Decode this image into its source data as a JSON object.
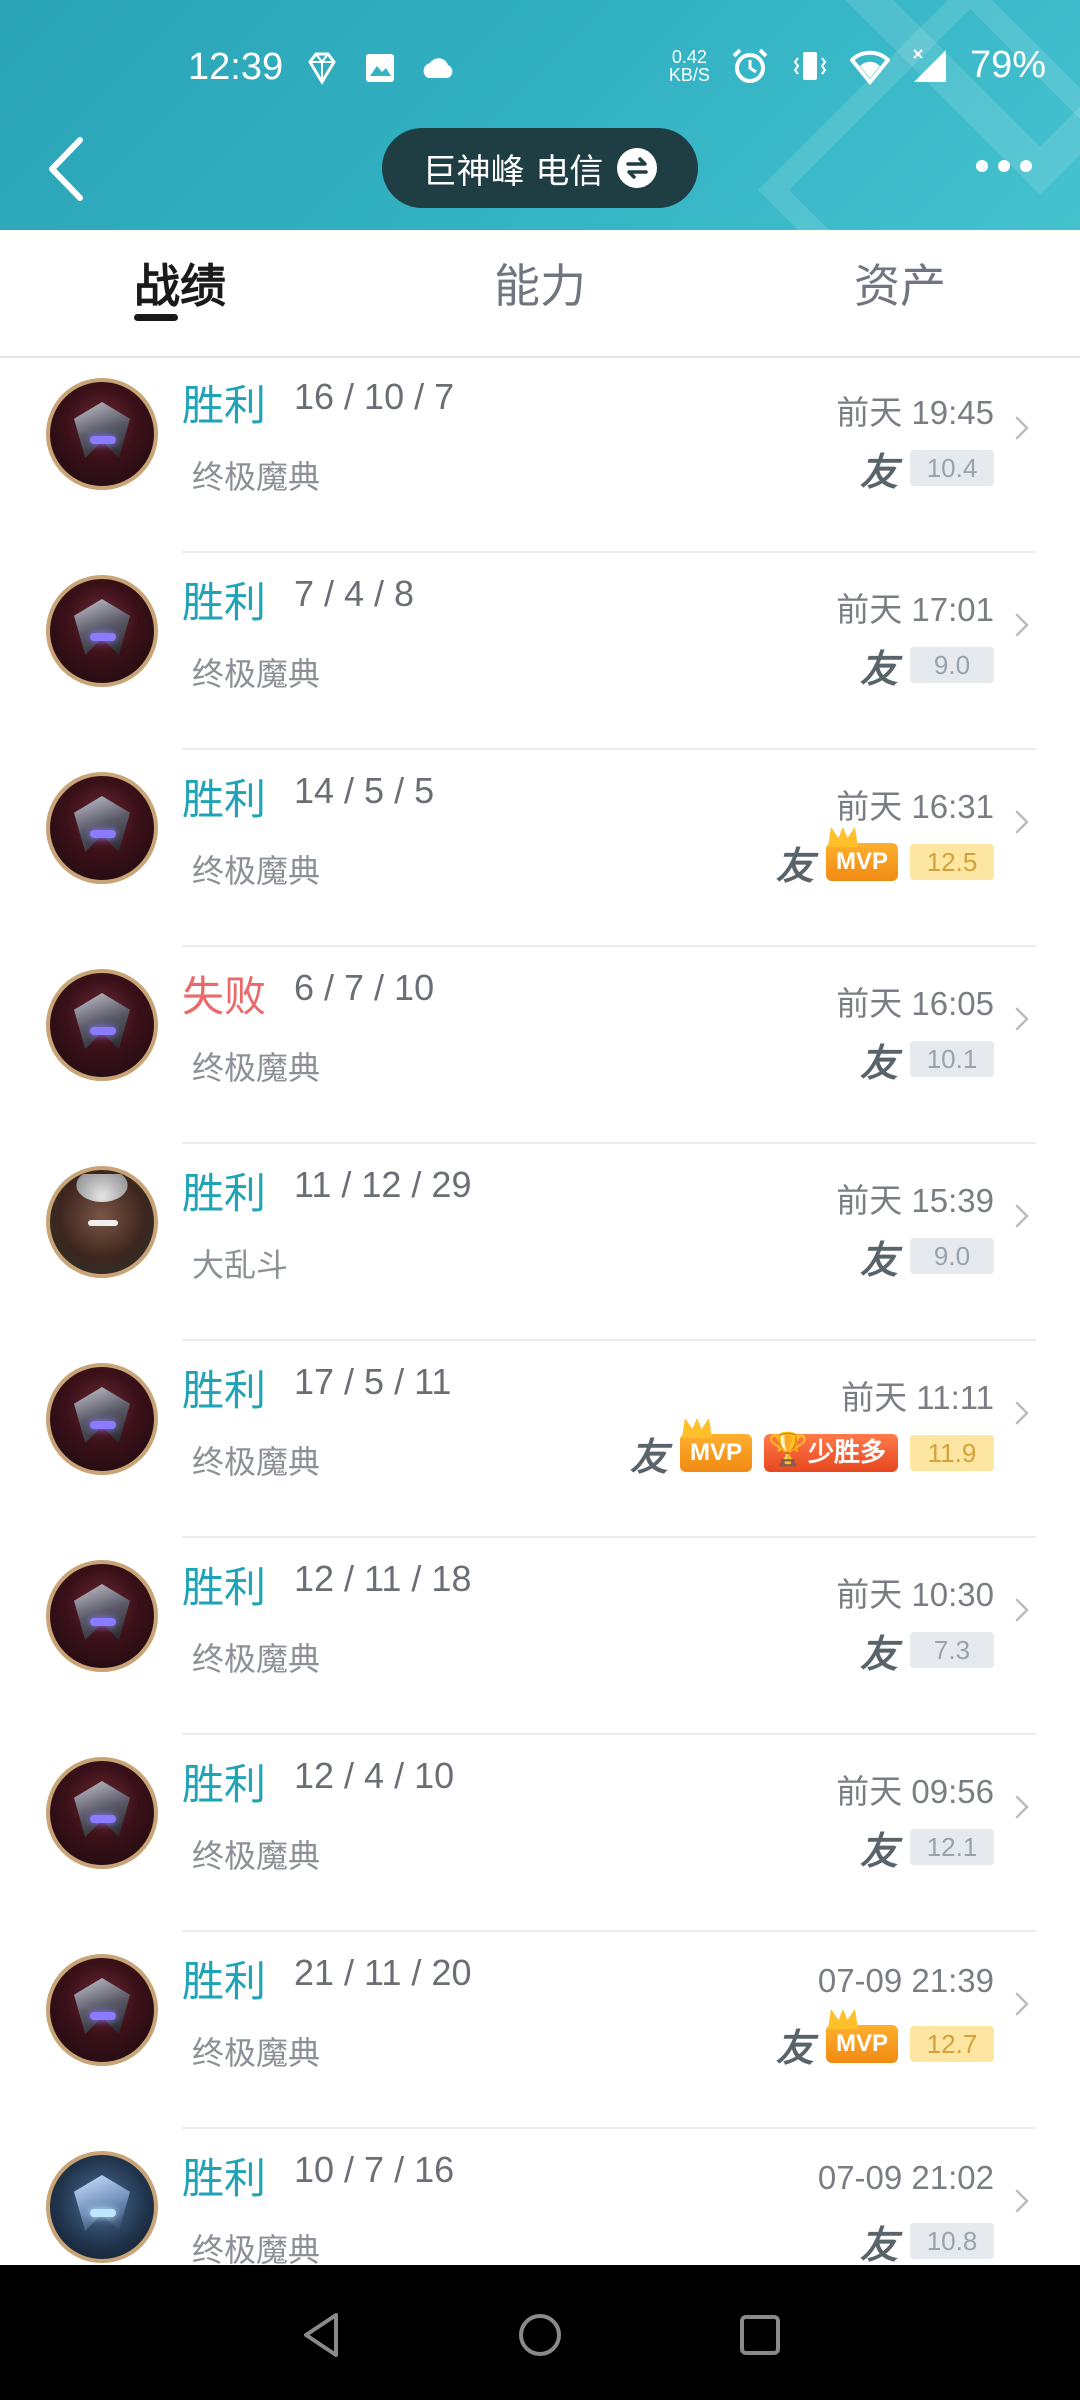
{
  "status_bar": {
    "time": "12:39",
    "net_speed_value": "0.42",
    "net_speed_unit": "KB/S",
    "battery": "79%",
    "icons_left": [
      "diamond-app-icon",
      "image-icon",
      "cloud-icon"
    ],
    "icons_right": [
      "alarm-icon",
      "vibrate-icon",
      "wifi-icon",
      "signal-icon"
    ]
  },
  "nav": {
    "server_label": "巨神峰 电信",
    "back_icon": "back-chevron-icon",
    "more_icon": "more-dots-icon",
    "swap_icon": "swap-icon"
  },
  "tabs": [
    {
      "label": "战绩",
      "active": true
    },
    {
      "label": "能力",
      "active": false
    },
    {
      "label": "资产",
      "active": false
    }
  ],
  "matches": [
    {
      "result": "胜利",
      "outcome": "win",
      "kda": "16 / 10 / 7",
      "mode": "终极魔典",
      "time": "前天 19:45",
      "friend": "友",
      "mvp": false,
      "few_wins": false,
      "score": "10.4",
      "score_style": "grey",
      "avatar": "a"
    },
    {
      "result": "胜利",
      "outcome": "win",
      "kda": "7 / 4 / 8",
      "mode": "终极魔典",
      "time": "前天 17:01",
      "friend": "友",
      "mvp": false,
      "few_wins": false,
      "score": "9.0",
      "score_style": "grey",
      "avatar": "a"
    },
    {
      "result": "胜利",
      "outcome": "win",
      "kda": "14 / 5 / 5",
      "mode": "终极魔典",
      "time": "前天 16:31",
      "friend": "友",
      "mvp": true,
      "few_wins": false,
      "score": "12.5",
      "score_style": "gold",
      "avatar": "a"
    },
    {
      "result": "失败",
      "outcome": "lose",
      "kda": "6 / 7 / 10",
      "mode": "终极魔典",
      "time": "前天 16:05",
      "friend": "友",
      "mvp": false,
      "few_wins": false,
      "score": "10.1",
      "score_style": "grey",
      "avatar": "a"
    },
    {
      "result": "胜利",
      "outcome": "win",
      "kda": "11 / 12 / 29",
      "mode": "大乱斗",
      "time": "前天 15:39",
      "friend": "友",
      "mvp": false,
      "few_wins": false,
      "score": "9.0",
      "score_style": "grey",
      "avatar": "b"
    },
    {
      "result": "胜利",
      "outcome": "win",
      "kda": "17 / 5 / 11",
      "mode": "终极魔典",
      "time": "前天 11:11",
      "friend": "友",
      "mvp": true,
      "few_wins": true,
      "few_wins_label": "少胜多",
      "score": "11.9",
      "score_style": "gold",
      "avatar": "a"
    },
    {
      "result": "胜利",
      "outcome": "win",
      "kda": "12 / 11 / 18",
      "mode": "终极魔典",
      "time": "前天 10:30",
      "friend": "友",
      "mvp": false,
      "few_wins": false,
      "score": "7.3",
      "score_style": "grey",
      "avatar": "a"
    },
    {
      "result": "胜利",
      "outcome": "win",
      "kda": "12 / 4 / 10",
      "mode": "终极魔典",
      "time": "前天 09:56",
      "friend": "友",
      "mvp": false,
      "few_wins": false,
      "score": "12.1",
      "score_style": "grey",
      "avatar": "a"
    },
    {
      "result": "胜利",
      "outcome": "win",
      "kda": "21 / 11 / 20",
      "mode": "终极魔典",
      "time": "07-09 21:39",
      "friend": "友",
      "mvp": true,
      "few_wins": false,
      "score": "12.7",
      "score_style": "gold",
      "avatar": "a"
    },
    {
      "result": "胜利",
      "outcome": "win",
      "kda": "10 / 7 / 16",
      "mode": "终极魔典",
      "time": "07-09 21:02",
      "friend": "友",
      "mvp": false,
      "few_wins": false,
      "score": "10.8",
      "score_style": "grey",
      "avatar": "c"
    }
  ],
  "mvp_label": "MVP",
  "colors": {
    "header": "#33b3c4",
    "win": "#1fa3b6",
    "lose": "#ea6a6a",
    "pill": "#1f3e44"
  },
  "system_nav": [
    "back-triangle-icon",
    "home-circle-icon",
    "recent-square-icon"
  ]
}
